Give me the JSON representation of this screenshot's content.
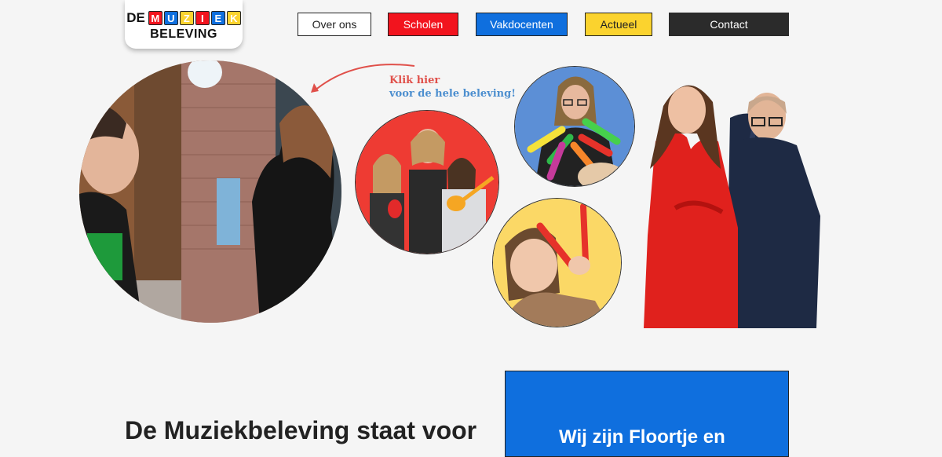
{
  "logo": {
    "prefix": "DE",
    "letters": [
      {
        "char": "M",
        "color": "#f2141e"
      },
      {
        "char": "U",
        "color": "#0f6fde"
      },
      {
        "char": "Z",
        "color": "#fbd32e"
      },
      {
        "char": "I",
        "color": "#f2141e"
      },
      {
        "char": "E",
        "color": "#0f6fde"
      },
      {
        "char": "K",
        "color": "#fbd32e"
      }
    ],
    "word2": "BELEVING"
  },
  "nav": {
    "items": [
      {
        "label": "Over ons",
        "color": "#ffffff"
      },
      {
        "label": "Scholen",
        "color": "#f2141e"
      },
      {
        "label": "Vakdocenten",
        "color": "#0f6fde"
      },
      {
        "label": "Actueel",
        "color": "#fbd32e"
      },
      {
        "label": "Contact",
        "color": "#2b2b2b"
      }
    ]
  },
  "hero": {
    "callout_line1": "Klik hier",
    "callout_line2": "voor de hele beleving!",
    "callout_colors": {
      "line1": "#e0504a",
      "line2": "#4d8fcf"
    },
    "circle_colors": {
      "red": "#ee3b33",
      "blue": "#5c8fd6",
      "yellow": "#fbd866"
    }
  },
  "intro": {
    "headline": "De Muziekbeleving staat voor"
  },
  "about": {
    "title": "Wij zijn Floortje en",
    "background": "#0f6fde"
  }
}
